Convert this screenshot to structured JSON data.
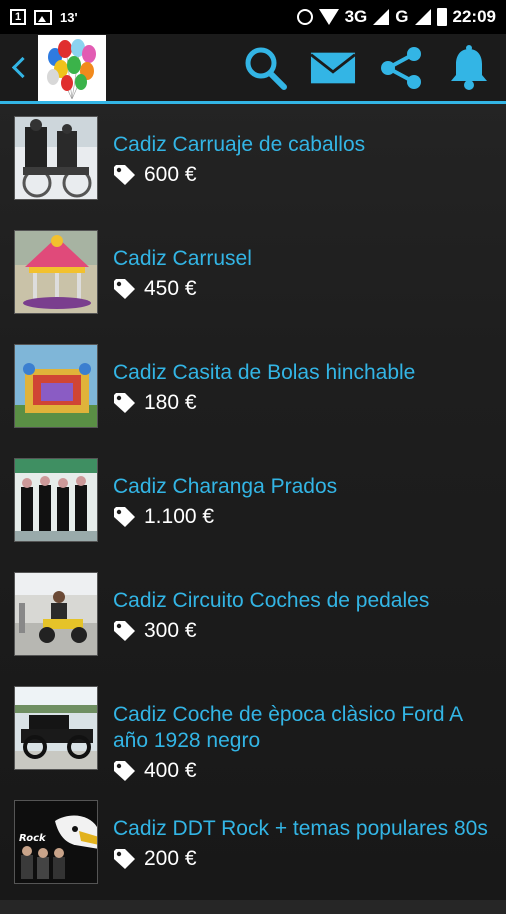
{
  "status": {
    "temp": "13'",
    "network_3g": "3G",
    "network_g": "G",
    "time": "22:09"
  },
  "appbar": {
    "back_icon": "chevron-left-icon",
    "logo": "balloons-logo",
    "accent": "#33b5e5",
    "actions": [
      "search-icon",
      "mail-icon",
      "share-icon",
      "bell-icon"
    ]
  },
  "items": [
    {
      "title": "Cadiz Carruaje de caballos",
      "price": "600 €"
    },
    {
      "title": "Cadiz Carrusel",
      "price": "450 €"
    },
    {
      "title": "Cadiz Casita de Bolas hinchable",
      "price": "180 €"
    },
    {
      "title": "Cadiz Charanga Prados",
      "price": "1.100 €"
    },
    {
      "title": "Cadiz Circuito Coches de pedales",
      "price": "300 €"
    },
    {
      "title": "Cadiz Coche de època clàsico Ford A año 1928 negro",
      "price": "400 €"
    },
    {
      "title": "Cadiz DDT Rock + temas populares 80s",
      "price": "200 €",
      "thumb_text": "Rock"
    }
  ]
}
